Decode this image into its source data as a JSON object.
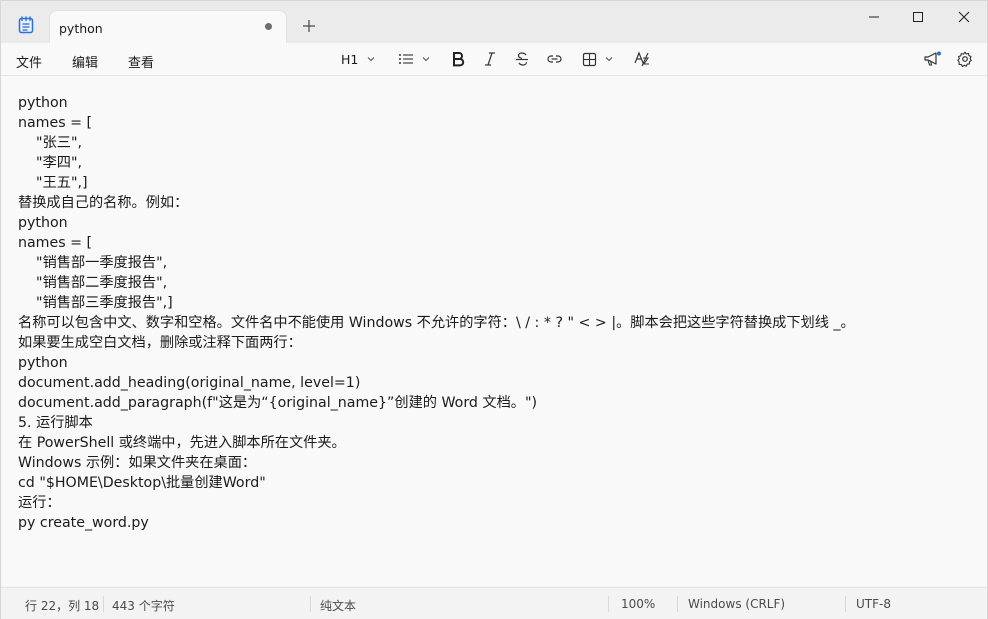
{
  "titlebar": {
    "tab_title": "python",
    "new_tab_symbol": "+",
    "tab_modified_icon": "dot-icon",
    "window_controls": [
      "minimize-icon",
      "maximize-icon",
      "close-icon"
    ]
  },
  "menu": {
    "file": "文件",
    "edit": "编辑",
    "view": "查看"
  },
  "toolbar": {
    "heading": "H1",
    "icons": [
      "list-icon",
      "bold-icon",
      "italic-icon",
      "strikethrough-icon",
      "link-icon",
      "table-icon",
      "clear-format-icon",
      "megaphone-icon",
      "gear-icon"
    ]
  },
  "editor": {
    "lines": [
      "python",
      "names = [",
      "    \"张三\",",
      "    \"李四\",",
      "    \"王五\",]",
      "替换成自己的名称。例如：",
      "python",
      "names = [",
      "    \"销售部一季度报告\",",
      "    \"销售部二季度报告\",",
      "    \"销售部三季度报告\",]",
      "名称可以包含中文、数字和空格。文件名中不能使用 Windows 不允许的字符：\\ / : * ? \" < > |。脚本会把这些字符替换成下划线 _。",
      "如果要生成空白文档，删除或注释下面两行：",
      "python",
      "document.add_heading(original_name, level=1)",
      "document.add_paragraph(f\"这是为“{original_name}”创建的 Word 文档。\")",
      "5. 运行脚本",
      "在 PowerShell 或终端中，先进入脚本所在文件夹。",
      "Windows 示例：如果文件夹在桌面：",
      "cd \"$HOME\\Desktop\\批量创建Word\"",
      "运行：",
      "py create_word.py"
    ]
  },
  "statusbar": {
    "position": "行 22，列 18",
    "char_count": "443 个字符",
    "format": "纯文本",
    "zoom": "100%",
    "line_ending": "Windows (CRLF)",
    "encoding": "UTF-8"
  },
  "colors": {
    "titlebar_bg": "#ebebeb",
    "editor_bg": "#f9f9f9",
    "app_icon_blue": "#2f6fd8",
    "text": "#1b1b1b"
  }
}
